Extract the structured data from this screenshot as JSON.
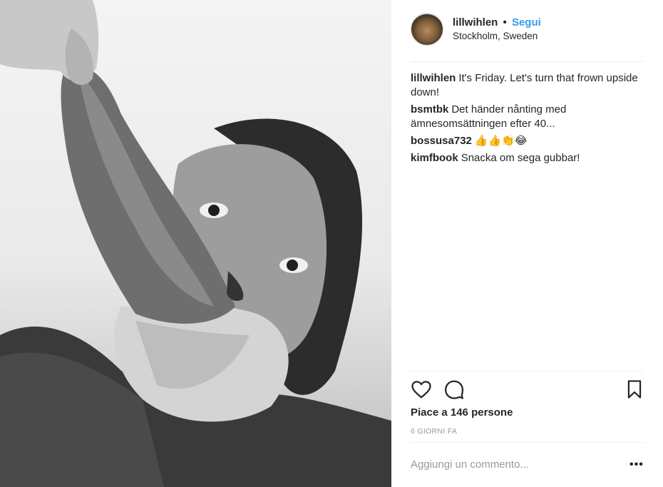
{
  "header": {
    "username": "lillwihlen",
    "separator": "•",
    "follow_label": "Segui",
    "location": "Stockholm, Sweden"
  },
  "comments": [
    {
      "user": "lillwihlen",
      "text": "It's Friday. Let's turn that frown upside down!"
    },
    {
      "user": "bsmtbk",
      "text": "Det händer nånting med ämnesomsättningen efter 40..."
    },
    {
      "user": "bossusa732",
      "text": "👍👍👏😂"
    },
    {
      "user": "kimfbook",
      "text": "Snacka om sega gubbar!"
    }
  ],
  "actions": {
    "like_icon": "heart-icon",
    "comment_icon": "speech-bubble-icon",
    "save_icon": "bookmark-icon"
  },
  "likes_text": "Piace a 146 persone",
  "timestamp": "6 GIORNI FA",
  "add_comment": {
    "placeholder": "Aggiungi un commento..."
  },
  "more_options_label": "•••"
}
